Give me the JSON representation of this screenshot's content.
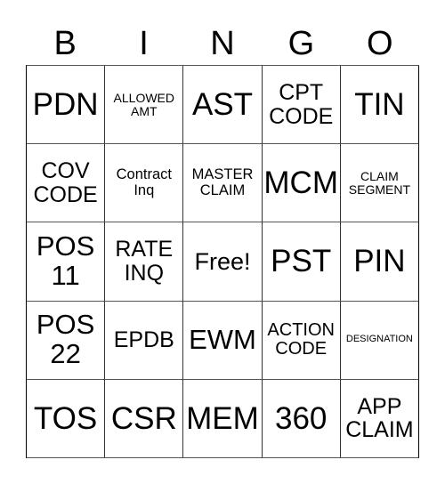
{
  "header": {
    "letters": [
      "B",
      "I",
      "N",
      "G",
      "O"
    ]
  },
  "board": {
    "rows": [
      [
        "PDN",
        "ALLOWED\nAMT",
        "AST",
        "CPT\nCODE",
        "TIN"
      ],
      [
        "COV\nCODE",
        "Contract\nInq",
        "MASTER\nCLAIM",
        "MCM",
        "CLAIM\nSEGMENT"
      ],
      [
        "POS\n11",
        "RATE\nINQ",
        "Free!",
        "PST",
        "PIN"
      ],
      [
        "POS\n22",
        "EPDB",
        "EWM",
        "ACTION\nCODE",
        "DESIGNATION"
      ],
      [
        "TOS",
        "CSR",
        "MEM",
        "360",
        "APP\nCLAIM"
      ]
    ],
    "free_space": "Free!"
  }
}
